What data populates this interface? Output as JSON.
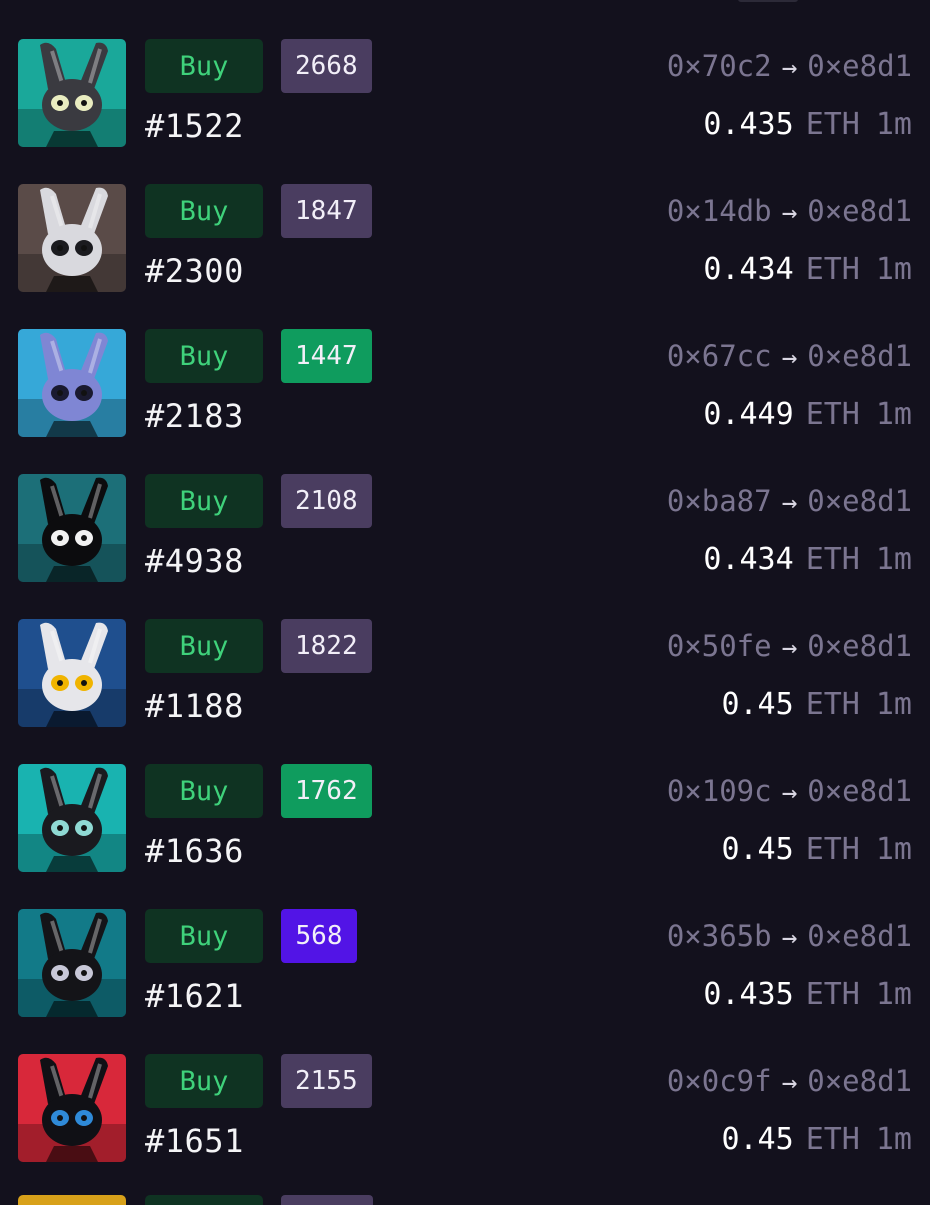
{
  "sales": [
    {
      "token": "#1522",
      "rank": "2668",
      "rank_style": "purple",
      "from": "0×70c2",
      "to": "0×e8d1",
      "price": "0.435",
      "unit": "ETH",
      "age": "1m",
      "bg": "#1aa89a",
      "face": "#3a3a40",
      "eye": "#e9ecc0"
    },
    {
      "token": "#2300",
      "rank": "1847",
      "rank_style": "purple",
      "from": "0×14db",
      "to": "0×e8d1",
      "price": "0.434",
      "unit": "ETH",
      "age": "1m",
      "bg": "#5a4b48",
      "face": "#d9d9de",
      "eye": "#1b1b1f"
    },
    {
      "token": "#2183",
      "rank": "1447",
      "rank_style": "green",
      "from": "0×67cc",
      "to": "0×e8d1",
      "price": "0.449",
      "unit": "ETH",
      "age": "1m",
      "bg": "#36a8d8",
      "face": "#7f86d4",
      "eye": "#1a1a30"
    },
    {
      "token": "#4938",
      "rank": "2108",
      "rank_style": "purple",
      "from": "0×ba87",
      "to": "0×e8d1",
      "price": "0.434",
      "unit": "ETH",
      "age": "1m",
      "bg": "#1c6f78",
      "face": "#0c0c0e",
      "eye": "#f2f2f2"
    },
    {
      "token": "#1188",
      "rank": "1822",
      "rank_style": "purple",
      "from": "0×50fe",
      "to": "0×e8d1",
      "price": "0.45",
      "unit": "ETH",
      "age": "1m",
      "bg": "#1f4f8e",
      "face": "#e6e6ea",
      "eye": "#f0b400"
    },
    {
      "token": "#1636",
      "rank": "1762",
      "rank_style": "green",
      "from": "0×109c",
      "to": "0×e8d1",
      "price": "0.45",
      "unit": "ETH",
      "age": "1m",
      "bg": "#19b3b0",
      "face": "#1a1a1f",
      "eye": "#8fd9d3"
    },
    {
      "token": "#1621",
      "rank": "568",
      "rank_style": "violet",
      "from": "0×365b",
      "to": "0×e8d1",
      "price": "0.435",
      "unit": "ETH",
      "age": "1m",
      "bg": "#127a88",
      "face": "#141418",
      "eye": "#c8c8d8"
    },
    {
      "token": "#1651",
      "rank": "2155",
      "rank_style": "purple",
      "from": "0×0c9f",
      "to": "0×e8d1",
      "price": "0.45",
      "unit": "ETH",
      "age": "1m",
      "bg": "#d8283a",
      "face": "#101015",
      "eye": "#2f8ad8"
    }
  ],
  "buy_label": "Buy",
  "arrow": "→"
}
